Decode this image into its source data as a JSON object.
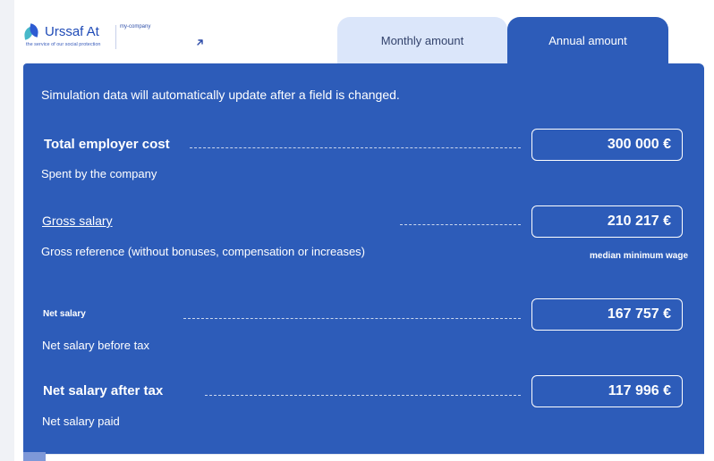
{
  "header": {
    "brand_name": "Urssaf At",
    "brand_tagline": "the service of our social protection",
    "brand_tag": "my-company",
    "external_link_icon": "arrow-up-right-icon"
  },
  "tabs": [
    {
      "label": "Monthly amount",
      "selected": false
    },
    {
      "label": "Annual amount",
      "selected": true
    }
  ],
  "panel": {
    "notice": "Simulation data will automatically update after a field is changed.",
    "rows": [
      {
        "label": "Total employer cost",
        "sub": "Spent by the company",
        "value": "300 000 €"
      },
      {
        "label": "Gross salary",
        "sub": "Gross reference (without bonuses, compensation or increases)",
        "value": "210 217 €"
      },
      {
        "label": "Net salary",
        "sub": "Net salary before tax",
        "value": "167 757 €"
      },
      {
        "label": "Net salary after tax",
        "sub": "Net salary paid",
        "value": "117 996 €"
      }
    ],
    "median_note": "median minimum wage"
  },
  "colors": {
    "panel": "#2d5cb9",
    "tab_inactive": "#dbe6fa",
    "brand": "#1f4bb7",
    "accent_teal": "#47b8c9"
  }
}
